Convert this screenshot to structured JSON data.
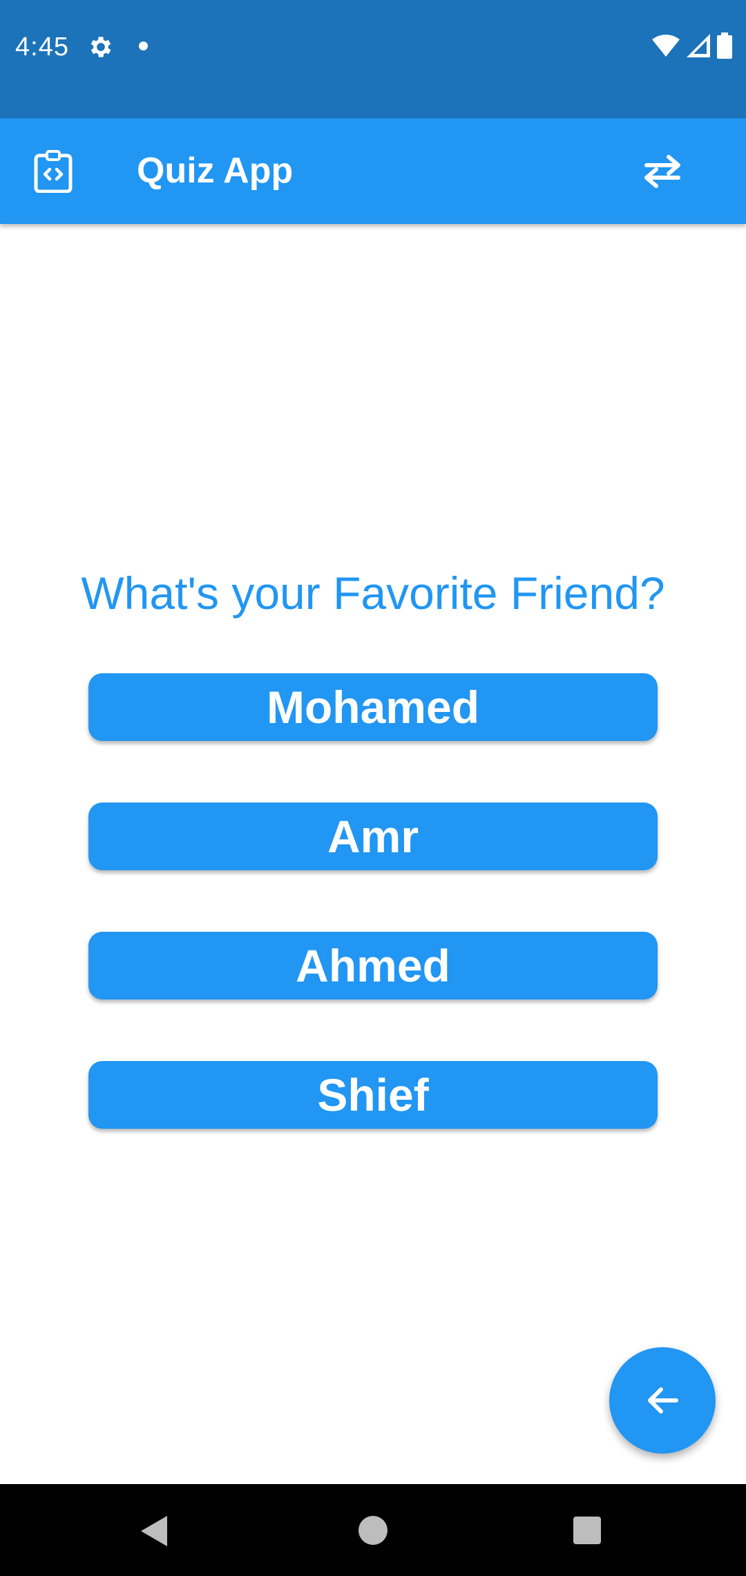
{
  "status_bar": {
    "time": "4:45",
    "icons": [
      "gear-icon",
      "notification-dot-icon",
      "wifi-icon",
      "signal-icon",
      "battery-icon"
    ]
  },
  "app_bar": {
    "title": "Quiz App",
    "leading_icon": "clipboard-code-icon",
    "action_icon": "swap-horizontal-icon"
  },
  "quiz": {
    "question": "What's your Favorite Friend?",
    "answers": [
      "Mohamed",
      "Amr",
      "Ahmed",
      "Shief"
    ]
  },
  "fab": {
    "icon": "arrow-back-icon"
  },
  "nav_bar": {
    "icons": [
      "nav-back-icon",
      "nav-home-icon",
      "nav-recents-icon"
    ]
  },
  "colors": {
    "status_bar": "#1c73b9",
    "primary": "#2196f3",
    "on_primary": "#ffffff",
    "background": "#ffffff",
    "nav_bar": "#000000"
  }
}
